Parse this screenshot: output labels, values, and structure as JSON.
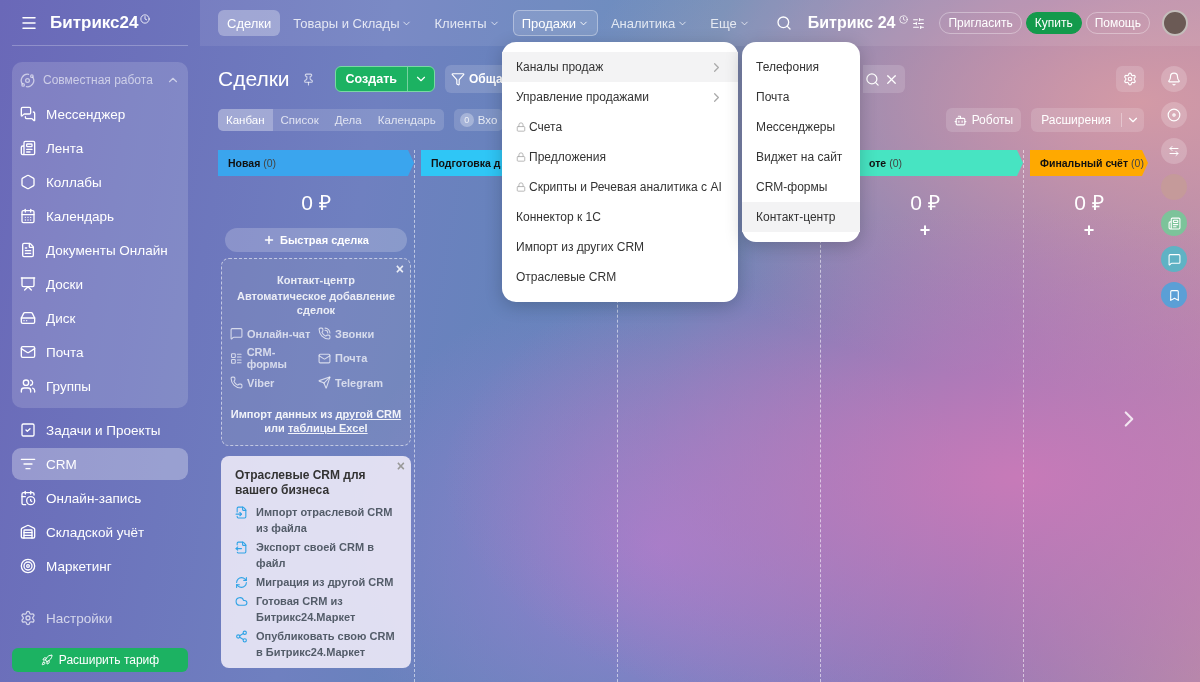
{
  "sidebar": {
    "logo": "Битрикс24",
    "group": {
      "label": "Совместная работа",
      "expanded": true,
      "items": [
        {
          "label": "Мессенджер",
          "selected": false
        },
        {
          "label": "Лента",
          "selected": false
        },
        {
          "label": "Коллабы",
          "selected": false
        },
        {
          "label": "Календарь",
          "selected": false
        },
        {
          "label": "Документы Онлайн",
          "selected": false
        },
        {
          "label": "Доски",
          "selected": false
        },
        {
          "label": "Диск",
          "selected": false
        },
        {
          "label": "Почта",
          "selected": false
        },
        {
          "label": "Группы",
          "selected": false
        }
      ]
    },
    "items": [
      {
        "label": "Задачи и Проекты",
        "selected": false
      },
      {
        "label": "CRM",
        "selected": true
      },
      {
        "label": "Онлайн-запись",
        "selected": false
      },
      {
        "label": "Складской учёт",
        "selected": false
      },
      {
        "label": "Маркетинг",
        "selected": false
      }
    ],
    "settings": "Настройки",
    "upgrade_button": "Расширить тариф"
  },
  "top_nav": {
    "tabs": [
      {
        "label": "Сделки",
        "selected": true,
        "open": false,
        "has_menu": false
      },
      {
        "label": "Товары и Склады",
        "selected": false,
        "open": false,
        "has_menu": true
      },
      {
        "label": "Клиенты",
        "selected": false,
        "open": false,
        "has_menu": true
      },
      {
        "label": "Продажи",
        "selected": false,
        "open": true,
        "has_menu": true
      },
      {
        "label": "Аналитика",
        "selected": false,
        "open": false,
        "has_menu": true
      },
      {
        "label": "Еще",
        "selected": false,
        "open": false,
        "has_menu": true
      }
    ],
    "brand": "Битрикс 24",
    "buttons": [
      {
        "label": "Пригласить",
        "kind": "outline"
      },
      {
        "label": "Купить",
        "kind": "primary"
      },
      {
        "label": "Помощь",
        "kind": "outline"
      }
    ]
  },
  "page": {
    "title": "Сделки",
    "create_button": "Создать",
    "filter": "Обща",
    "view_tabs": [
      {
        "label": "Канбан",
        "selected": true
      },
      {
        "label": "Список",
        "selected": false
      },
      {
        "label": "Дела",
        "selected": false
      },
      {
        "label": "Календарь",
        "selected": false
      }
    ],
    "counter": {
      "count": "0",
      "label": "Вхо"
    },
    "robots_button": "Роботы",
    "extensions_button": "Расширения"
  },
  "kanban": {
    "columns": [
      {
        "kind": "full",
        "title": "Новая",
        "count": "(0)",
        "color": "#3aa5ee",
        "amount": "0 ₽",
        "quick_add": "Быстрая сделка"
      },
      {
        "kind": "covered",
        "title": "Подготовка д",
        "color": "#2fc6f6"
      },
      {
        "kind": "hidden"
      },
      {
        "kind": "covered_left",
        "title": "оте",
        "count": "(0)",
        "color": "#47e4c2",
        "amount": "0 ₽",
        "add": "+"
      },
      {
        "kind": "full",
        "title": "Финальный счёт",
        "count": "(0)",
        "color": "#ffa900",
        "amount": "0 ₽",
        "add": "+"
      }
    ],
    "contact_card": {
      "title": "Контакт-центр",
      "subtitle": "Автоматическое добавление сделок",
      "close": "×",
      "channels": [
        "Онлайн-чат",
        "Звонки",
        "CRM-формы",
        "Почта",
        "Viber",
        "Telegram"
      ],
      "import": {
        "before": "Импорт данных из",
        "link1": "другой CRM",
        "middle": "или",
        "link2": "таблицы Excel"
      }
    },
    "industry_card": {
      "title": "Отраслевые CRM для вашего бизнеса",
      "close": "×",
      "items": [
        "Импорт отраслевой CRM из файла",
        "Экспорт своей CRM в файл",
        "Миграция из другой CRM",
        "Готовая CRM из Битрикс24.Маркет",
        "Опубликовать свою CRM в Битрикс24.Маркет"
      ]
    }
  },
  "sales_menu": {
    "items": [
      {
        "label": "Каналы продаж",
        "kind": "submenu",
        "selected": true
      },
      {
        "label": "Управление продажами",
        "kind": "submenu",
        "selected": false
      },
      {
        "label": "Счета",
        "kind": "locked",
        "selected": false
      },
      {
        "label": "Предложения",
        "kind": "locked",
        "selected": false
      },
      {
        "label": "Скрипты и Речевая аналитика с AI",
        "kind": "locked",
        "selected": false
      },
      {
        "label": "Коннектор к 1С",
        "kind": "plain",
        "selected": false
      },
      {
        "label": "Импорт из других CRM",
        "kind": "plain",
        "selected": false
      },
      {
        "label": "Отраслевые CRM",
        "kind": "plain",
        "selected": false
      }
    ],
    "submenu": [
      {
        "label": "Телефония",
        "selected": false
      },
      {
        "label": "Почта",
        "selected": false
      },
      {
        "label": "Мессенджеры",
        "selected": false
      },
      {
        "label": "Виджет на сайт",
        "selected": false
      },
      {
        "label": "CRM-формы",
        "selected": false
      },
      {
        "label": "Контакт-центр",
        "selected": true
      }
    ]
  }
}
